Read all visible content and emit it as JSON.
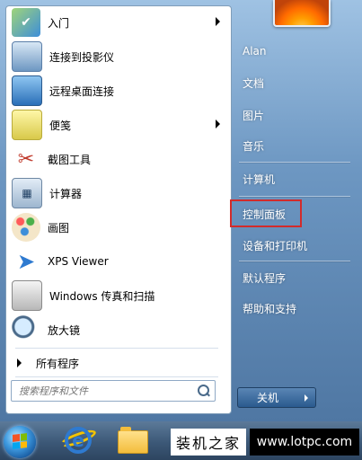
{
  "programs": [
    {
      "label": "入门",
      "icon": "getting-started-icon",
      "has_arrow": true
    },
    {
      "label": "连接到投影仪",
      "icon": "projector-icon",
      "has_arrow": false
    },
    {
      "label": "远程桌面连接",
      "icon": "remote-desktop-icon",
      "has_arrow": false
    },
    {
      "label": "便笺",
      "icon": "sticky-notes-icon",
      "has_arrow": true
    },
    {
      "label": "截图工具",
      "icon": "snipping-tool-icon",
      "has_arrow": false
    },
    {
      "label": "计算器",
      "icon": "calculator-icon",
      "has_arrow": false
    },
    {
      "label": "画图",
      "icon": "paint-icon",
      "has_arrow": false
    },
    {
      "label": "XPS Viewer",
      "icon": "xps-viewer-icon",
      "has_arrow": false
    },
    {
      "label": "Windows 传真和扫描",
      "icon": "fax-scan-icon",
      "has_arrow": false
    },
    {
      "label": "放大镜",
      "icon": "magnifier-icon",
      "has_arrow": false
    }
  ],
  "all_programs_label": "所有程序",
  "search": {
    "placeholder": "搜索程序和文件"
  },
  "right_menu": [
    {
      "label": "Alan"
    },
    {
      "label": "文档"
    },
    {
      "label": "图片"
    },
    {
      "label": "音乐"
    },
    {
      "label": "计算机"
    },
    {
      "label": "控制面板",
      "highlighted": true
    },
    {
      "label": "设备和打印机"
    },
    {
      "label": "默认程序"
    },
    {
      "label": "帮助和支持"
    }
  ],
  "shutdown_label": "关机",
  "taskbar": {
    "watermark_text": "装机之家",
    "url_text": "www.lotpc.com"
  },
  "colors": {
    "highlight_border": "#d22b2b",
    "start_menu_bg": "#6d97c2",
    "taskbar_bg": "#3c5877"
  }
}
